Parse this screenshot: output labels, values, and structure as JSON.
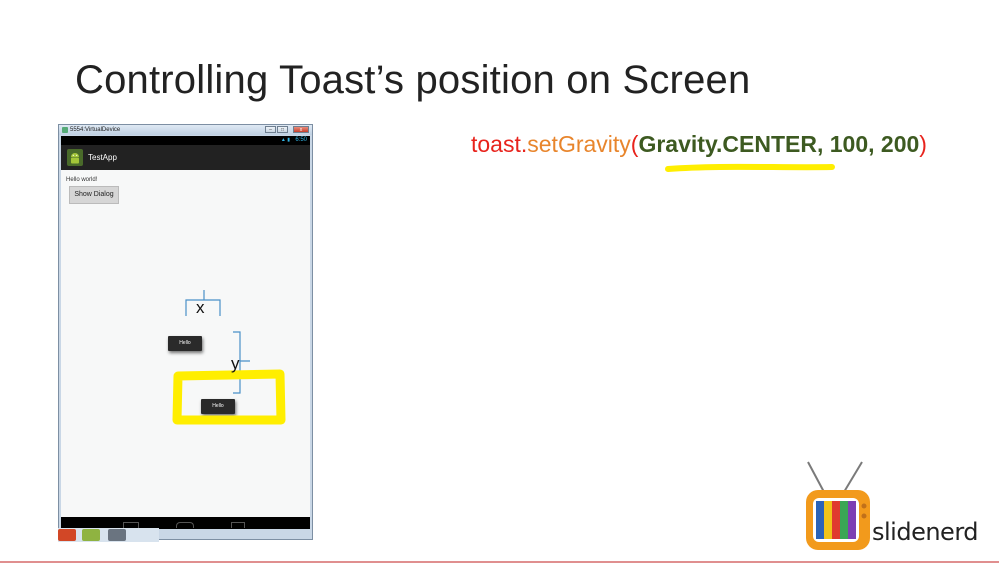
{
  "slide": {
    "title": "Controlling Toast’s position on Screen"
  },
  "emulator": {
    "window_title": "5554:VirtualDevice",
    "win_buttons": [
      "–",
      "□",
      "x"
    ],
    "status_time": "6:50",
    "status_icons": "▲ ▮",
    "app_name": "TestApp",
    "hello_text": "Hello world!",
    "show_dialog_label": "Show Dialog",
    "toast_default_text": "Hello",
    "toast_offset_text": "Hello"
  },
  "annotations": {
    "x_label": "x",
    "y_label": "y",
    "highlight_color": "#ffee00",
    "bracket_color": "#4a90c8"
  },
  "code": {
    "object": "toast",
    "dot": ".",
    "method": "setGravity",
    "open_paren": "(",
    "arg1": "Gravity.CENTER",
    "comma1": ", ",
    "arg2": "100",
    "comma2": ", ",
    "arg3": "200",
    "close_paren": ")",
    "colors": {
      "object": "#e8231c",
      "method": "#e8852c",
      "args": "#3d5a21"
    }
  },
  "logo": {
    "text": "slidenerd"
  }
}
